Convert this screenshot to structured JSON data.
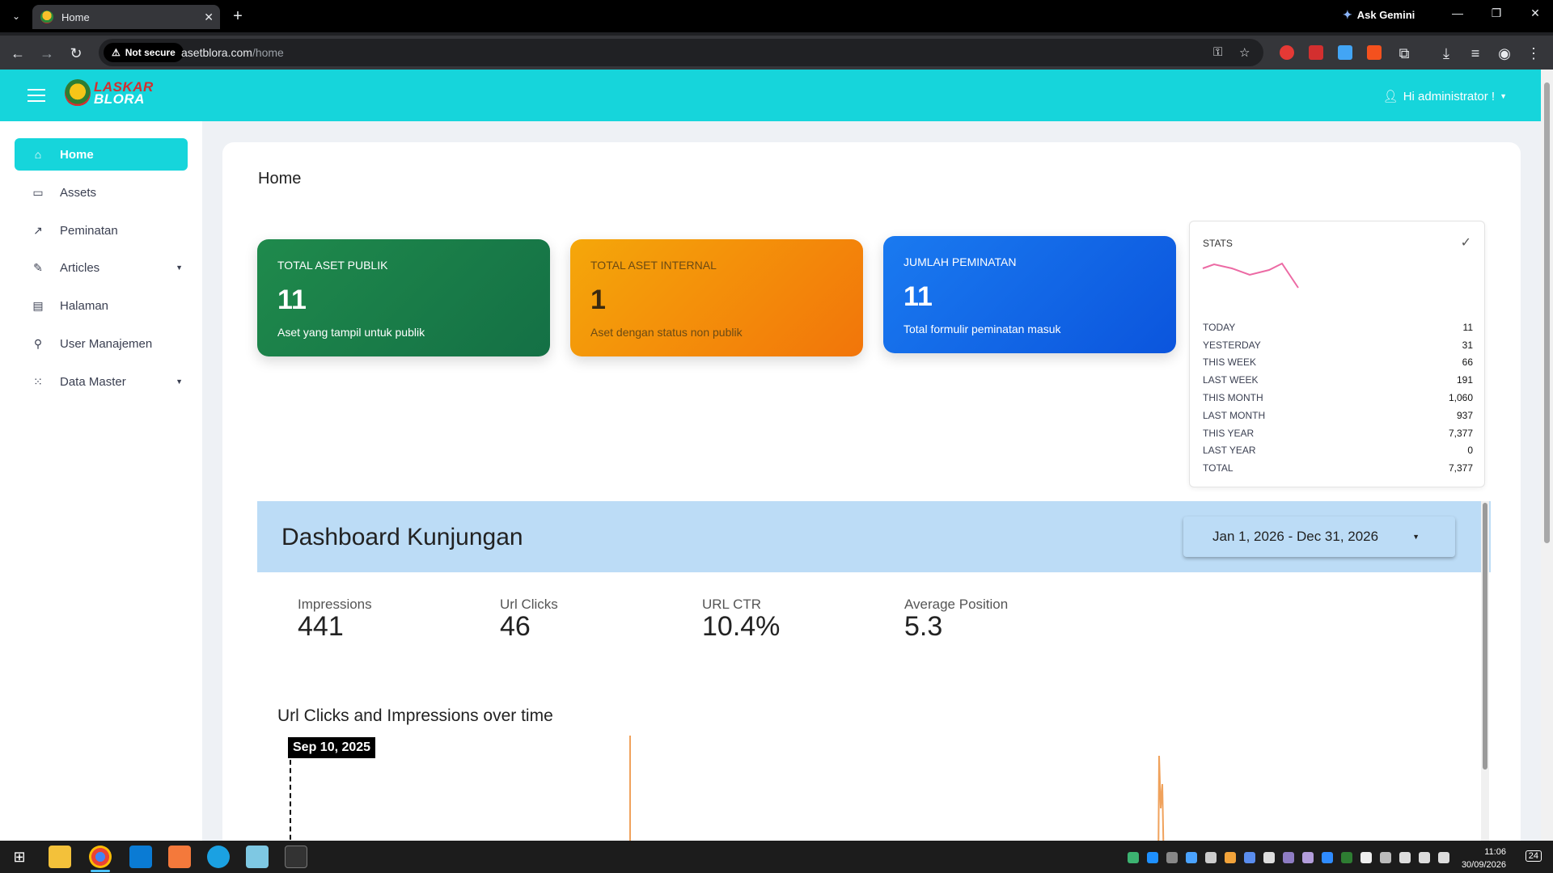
{
  "browser": {
    "tab_title": "Home",
    "ask_gemini": "Ask Gemini",
    "not_secure": "Not secure",
    "url_domain": "asetblora.com",
    "url_path": "/home"
  },
  "topbar": {
    "logo_line1": "LASKAR",
    "logo_line2": "BLORA",
    "user_greeting": "Hi administrator !"
  },
  "sidebar": {
    "items": [
      {
        "label": "Home",
        "icon": "home-icon"
      },
      {
        "label": "Assets",
        "icon": "box-icon"
      },
      {
        "label": "Peminatan",
        "icon": "trend-icon"
      },
      {
        "label": "Articles",
        "icon": "edit-icon"
      },
      {
        "label": "Halaman",
        "icon": "page-icon"
      },
      {
        "label": "User Manajemen",
        "icon": "user-icon"
      },
      {
        "label": "Data Master",
        "icon": "grid-icon"
      }
    ]
  },
  "main": {
    "title": "Home"
  },
  "kpis": [
    {
      "title": "TOTAL ASET PUBLIK",
      "value": "11",
      "subtitle": "Aset yang tampil untuk publik",
      "color": "#1f8a4c"
    },
    {
      "title": "TOTAL ASET INTERNAL",
      "value": "1",
      "subtitle": "Aset dengan status non publik",
      "color": "#f5a70a"
    },
    {
      "title": "JUMLAH PEMINATAN",
      "value": "11",
      "subtitle": "Total formulir peminatan masuk",
      "color": "#1a7af0"
    }
  ],
  "stats": {
    "title": "STATS",
    "rows": [
      {
        "label": "TODAY",
        "value": "11"
      },
      {
        "label": "YESTERDAY",
        "value": "31"
      },
      {
        "label": "THIS WEEK",
        "value": "66"
      },
      {
        "label": "LAST WEEK",
        "value": "191"
      },
      {
        "label": "THIS MONTH",
        "value": "1,060"
      },
      {
        "label": "LAST MONTH",
        "value": "937"
      },
      {
        "label": "THIS YEAR",
        "value": "7,377"
      },
      {
        "label": "LAST YEAR",
        "value": "0"
      },
      {
        "label": "TOTAL",
        "value": "7,377"
      }
    ],
    "spark_color": "#ec6aa4"
  },
  "dashboard": {
    "title": "Dashboard Kunjungan",
    "date_range": "Jan 1, 2026 - Dec 31, 2026",
    "metrics": [
      {
        "label": "Impressions",
        "value": "441"
      },
      {
        "label": "Url Clicks",
        "value": "46"
      },
      {
        "label": "URL CTR",
        "value": "10.4%"
      },
      {
        "label": "Average Position",
        "value": "5.3"
      }
    ],
    "chart_title": "Url Clicks and Impressions over time",
    "tooltip": "Sep 10, 2025",
    "accent": "#bcdcf6"
  },
  "taskbar": {
    "time": "11:06",
    "date": "30/09/2026",
    "notifications": "24"
  }
}
